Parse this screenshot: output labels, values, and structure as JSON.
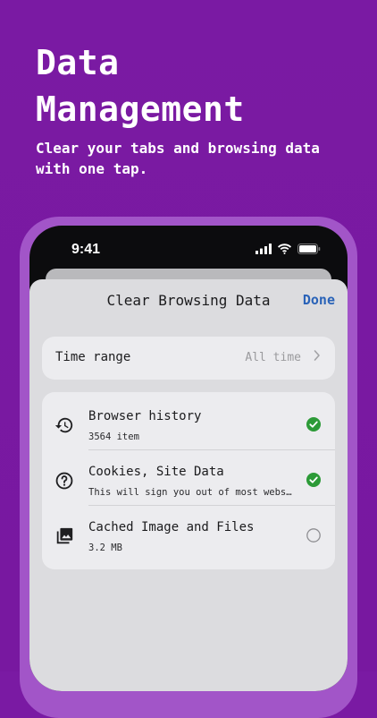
{
  "hero": {
    "title": "Data\nManagement",
    "subtitle": "Clear your tabs and browsing data with one tap."
  },
  "status_bar": {
    "time": "9:41",
    "icons": [
      "cellular-signal-icon",
      "wifi-icon",
      "battery-icon"
    ]
  },
  "sheet": {
    "title": "Clear Browsing Data",
    "done_label": "Done",
    "time_range": {
      "label": "Time range",
      "value": "All time"
    },
    "items": [
      {
        "icon": "history-icon",
        "title": "Browser history",
        "subtitle": "3564 item",
        "checked": true
      },
      {
        "icon": "help-circle-icon",
        "title": "Cookies, Site Data",
        "subtitle": "This will sign you out of most websites.",
        "checked": true
      },
      {
        "icon": "image-gallery-icon",
        "title": "Cached Image and Files",
        "subtitle": "3.2 MB",
        "checked": false
      }
    ]
  },
  "colors": {
    "background": "#7a1aa3",
    "accent": "#2a63b8",
    "check": "#2c9a37"
  }
}
